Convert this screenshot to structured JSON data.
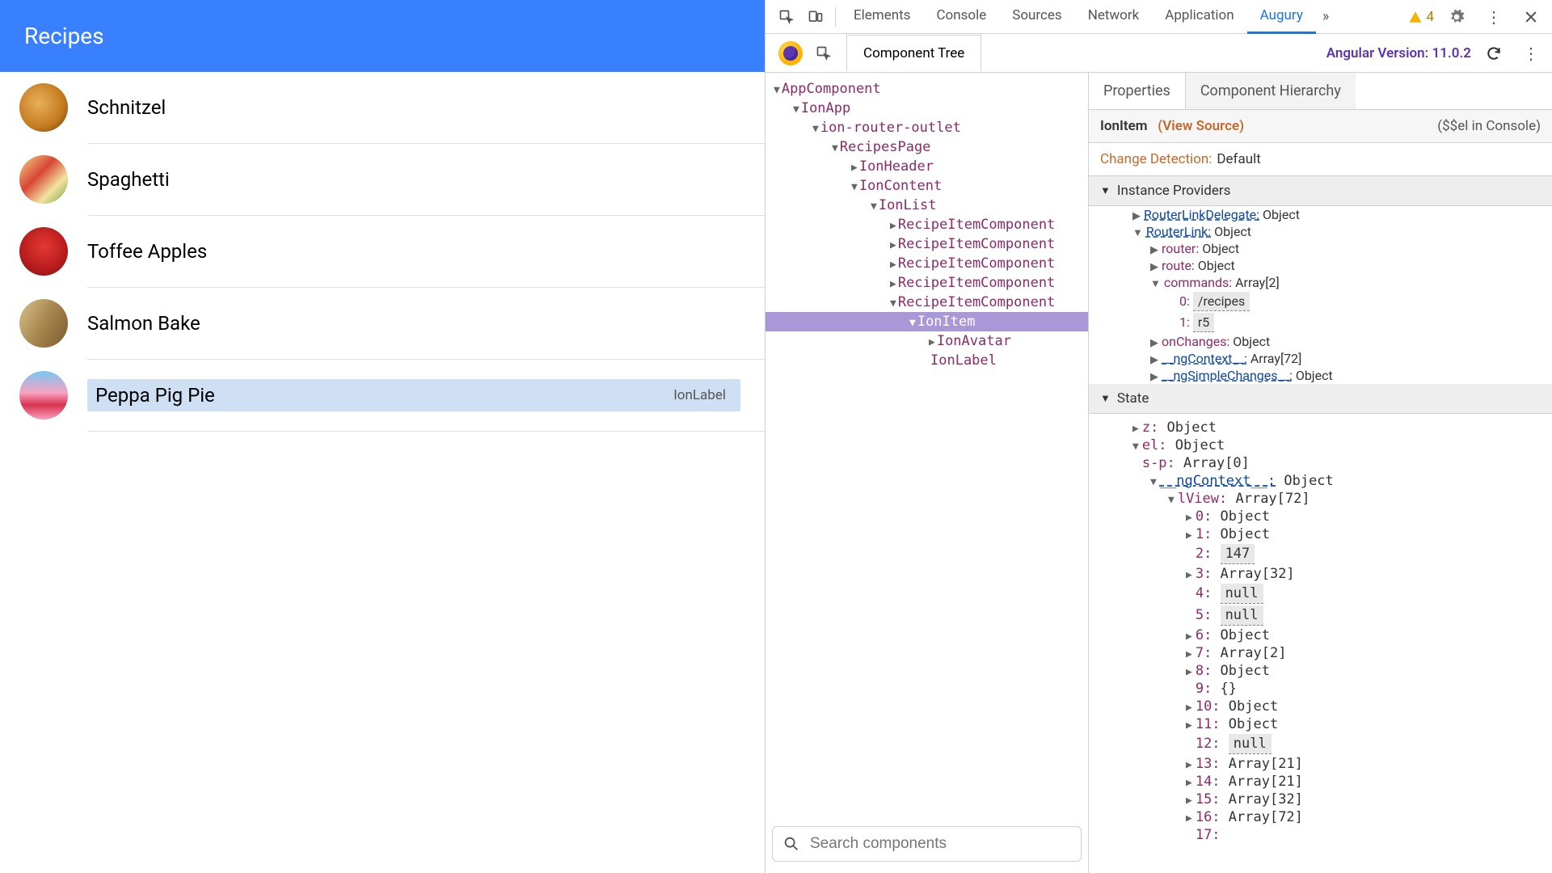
{
  "app": {
    "header_title": "Recipes",
    "recipes": [
      "Schnitzel",
      "Spaghetti",
      "Toffee Apples",
      "Salmon Bake",
      "Peppa Pig Pie"
    ],
    "highlighted_index": 4,
    "highlight_label": "IonLabel"
  },
  "devtools": {
    "tabs": [
      "Elements",
      "Console",
      "Sources",
      "Network",
      "Application",
      "Augury"
    ],
    "active_tab": "Augury",
    "warning_count": "4"
  },
  "augury": {
    "tab_label": "Component Tree",
    "version_label": "Angular Version: 11.0.2",
    "search_placeholder": "Search components",
    "tree": [
      {
        "d": 0,
        "a": "▼",
        "n": "AppComponent"
      },
      {
        "d": 1,
        "a": "▼",
        "n": "IonApp"
      },
      {
        "d": 2,
        "a": "▼",
        "n": "ion-router-outlet"
      },
      {
        "d": 3,
        "a": "▼",
        "n": "RecipesPage"
      },
      {
        "d": 4,
        "a": "▶",
        "n": "IonHeader"
      },
      {
        "d": 4,
        "a": "▼",
        "n": "IonContent"
      },
      {
        "d": 5,
        "a": "▼",
        "n": "IonList"
      },
      {
        "d": 6,
        "a": "▶",
        "n": "RecipeItemComponent"
      },
      {
        "d": 6,
        "a": "▶",
        "n": "RecipeItemComponent"
      },
      {
        "d": 6,
        "a": "▶",
        "n": "RecipeItemComponent"
      },
      {
        "d": 6,
        "a": "▶",
        "n": "RecipeItemComponent"
      },
      {
        "d": 6,
        "a": "▼",
        "n": "RecipeItemComponent"
      },
      {
        "d": 7,
        "a": "▼",
        "n": "IonItem",
        "sel": true
      },
      {
        "d": 8,
        "a": "▶",
        "n": "IonAvatar"
      },
      {
        "d": 8,
        "a": "",
        "n": "IonLabel"
      }
    ]
  },
  "properties": {
    "tabs": [
      "Properties",
      "Component Hierarchy"
    ],
    "active_tab": "Properties",
    "component_name": "IonItem",
    "view_source": "(View Source)",
    "dollar_hint": "($$el in Console)",
    "change_detection_label": "Change Detection:",
    "change_detection_value": "Default",
    "instance_providers_label": "Instance Providers",
    "state_label": "State",
    "instance_rows": [
      {
        "d": 0,
        "a": "▶",
        "k": "RouterLinkDelegate:",
        "kc": "u",
        "v": " Object"
      },
      {
        "d": 0,
        "a": "▼",
        "k": "RouterLink:",
        "kc": "u",
        "v": " Object"
      },
      {
        "d": 1,
        "a": "▶",
        "k": "router:",
        "v": " Object"
      },
      {
        "d": 1,
        "a": "▶",
        "k": "route:",
        "v": " Object"
      },
      {
        "d": 1,
        "a": "▼",
        "k": "commands:",
        "v": " Array[2]"
      },
      {
        "d": 2,
        "a": "",
        "k": "0:",
        "v": "",
        "box": "/recipes"
      },
      {
        "d": 2,
        "a": "",
        "k": "1:",
        "v": "",
        "box": "r5"
      },
      {
        "d": 1,
        "a": "▶",
        "k": "onChanges:",
        "v": " Object"
      },
      {
        "d": 1,
        "a": "▶",
        "k": "__ngContext__:",
        "kc": "u",
        "v": " Array[72]"
      },
      {
        "d": 1,
        "a": "▶",
        "k": "__ngSimpleChanges__:",
        "kc": "u",
        "v": " Object"
      }
    ],
    "state_rows": [
      {
        "d": 0,
        "a": "▶",
        "k": "z:",
        "v": " Object"
      },
      {
        "d": 0,
        "a": "▼",
        "k": "el:",
        "v": " Object"
      },
      {
        "d": 0,
        "a": "",
        "k": "s-p:",
        "v": " Array[0]"
      },
      {
        "d": 1,
        "a": "▼",
        "k": "__ngContext__:",
        "kc": "u",
        "v": " Object"
      },
      {
        "d": 2,
        "a": "▼",
        "k": "lView:",
        "v": " Array[72]"
      },
      {
        "d": 3,
        "a": "▶",
        "k": "0:",
        "v": " Object"
      },
      {
        "d": 3,
        "a": "▶",
        "k": "1:",
        "v": " Object"
      },
      {
        "d": 3,
        "a": "",
        "k": "2:",
        "v": "",
        "box": "147"
      },
      {
        "d": 3,
        "a": "▶",
        "k": "3:",
        "v": " Array[32]"
      },
      {
        "d": 3,
        "a": "",
        "k": "4:",
        "v": "",
        "box": "null"
      },
      {
        "d": 3,
        "a": "",
        "k": "5:",
        "v": "",
        "box": "null"
      },
      {
        "d": 3,
        "a": "▶",
        "k": "6:",
        "v": " Object"
      },
      {
        "d": 3,
        "a": "▶",
        "k": "7:",
        "v": " Array[2]"
      },
      {
        "d": 3,
        "a": "▶",
        "k": "8:",
        "v": " Object"
      },
      {
        "d": 3,
        "a": "",
        "k": "9:",
        "v": " {}"
      },
      {
        "d": 3,
        "a": "▶",
        "k": "10:",
        "v": " Object"
      },
      {
        "d": 3,
        "a": "▶",
        "k": "11:",
        "v": " Object"
      },
      {
        "d": 3,
        "a": "",
        "k": "12:",
        "v": "",
        "box": "null"
      },
      {
        "d": 3,
        "a": "▶",
        "k": "13:",
        "v": " Array[21]"
      },
      {
        "d": 3,
        "a": "▶",
        "k": "14:",
        "v": " Array[21]"
      },
      {
        "d": 3,
        "a": "▶",
        "k": "15:",
        "v": " Array[32]"
      },
      {
        "d": 3,
        "a": "▶",
        "k": "16:",
        "v": " Array[72]"
      },
      {
        "d": 3,
        "a": "",
        "k": "17:",
        "v": ""
      }
    ]
  }
}
